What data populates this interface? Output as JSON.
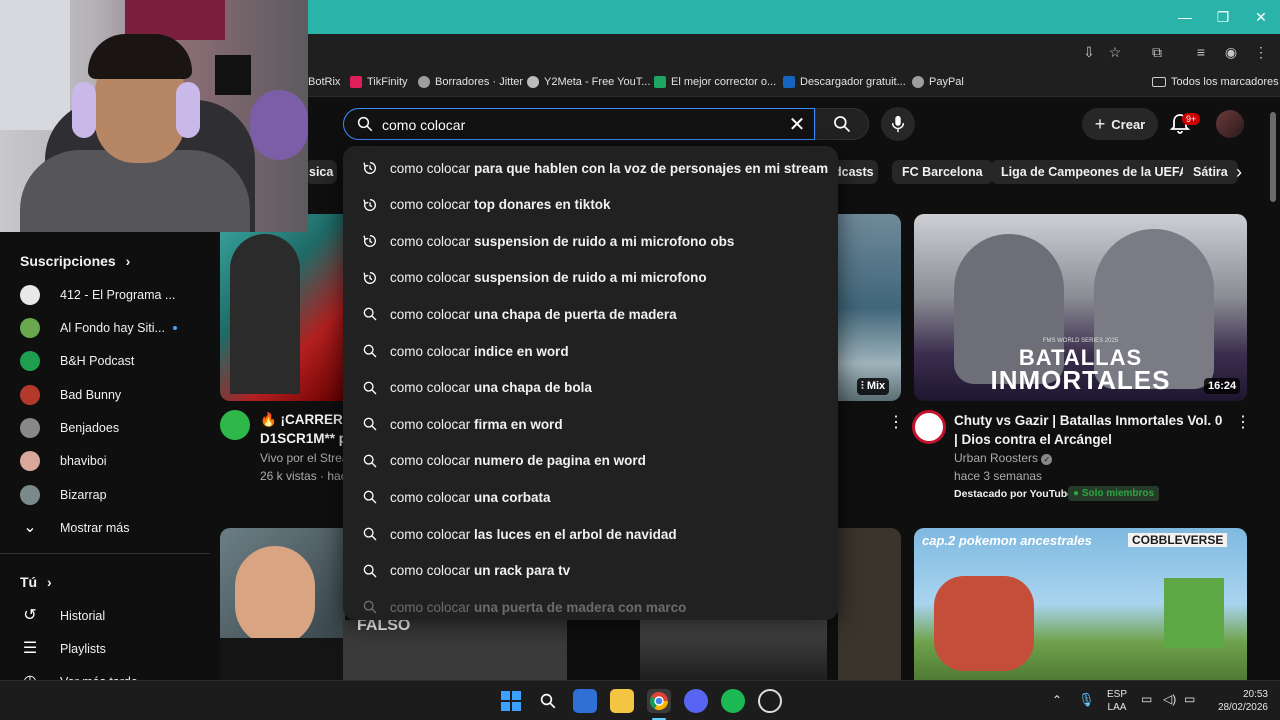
{
  "browser": {
    "window_controls": [
      "—",
      "❐",
      "✕"
    ],
    "bookmarks": [
      {
        "label": "BotRix",
        "color": "#5a5a5a"
      },
      {
        "label": "TikFinity",
        "color": "#e01e5a"
      },
      {
        "label": "Borradores · Jitter",
        "color": "#9e9e9e"
      },
      {
        "label": "Y2Meta - Free YouT...",
        "color": "#bdbdbd"
      },
      {
        "label": "El mejor corrector o...",
        "color": "#1fa463"
      },
      {
        "label": "Descargador gratuit...",
        "color": "#1565c0"
      },
      {
        "label": "PayPal",
        "color": "#9e9e9e"
      }
    ],
    "all_bookmarks": "Todos los marcadores"
  },
  "search": {
    "query": "como colocar",
    "suggestions": [
      {
        "prefix": "como colocar",
        "rest": " para que hablen con la voz de personajes en mi stream",
        "type": "history"
      },
      {
        "prefix": "como colocar",
        "rest": " top donares en tiktok",
        "type": "history"
      },
      {
        "prefix": "como colocar",
        "rest": " suspension de ruido a mi microfono obs",
        "type": "history"
      },
      {
        "prefix": "como colocar",
        "rest": " suspension de ruido a mi microfono",
        "type": "history"
      },
      {
        "prefix": "como colocar",
        "rest": " una chapa de puerta de madera",
        "type": "search"
      },
      {
        "prefix": "como colocar",
        "rest": " indice en word",
        "type": "search"
      },
      {
        "prefix": "como colocar",
        "rest": " una chapa de bola",
        "type": "search"
      },
      {
        "prefix": "como colocar",
        "rest": " firma en word",
        "type": "search"
      },
      {
        "prefix": "como colocar",
        "rest": " numero de pagina en word",
        "type": "search"
      },
      {
        "prefix": "como colocar",
        "rest": " una corbata",
        "type": "search"
      },
      {
        "prefix": "como colocar",
        "rest": " las luces en el arbol de navidad",
        "type": "search"
      },
      {
        "prefix": "como colocar",
        "rest": " un rack para tv",
        "type": "search"
      },
      {
        "prefix": "como colocar",
        "rest": " una puerta de madera con marco",
        "type": "search"
      }
    ]
  },
  "header": {
    "create_label": "Crear",
    "notif_badge": "9+"
  },
  "chips": [
    "sica",
    "dcasts",
    "FC Barcelona",
    "Liga de Campeones de la UEFA",
    "Sátira"
  ],
  "sidebar": {
    "subscriptions_title": "Suscripciones",
    "channels": [
      {
        "name": "412 - El Programa ...",
        "color": "#e8e8e8",
        "dot": false
      },
      {
        "name": "Al Fondo hay Siti...",
        "color": "#6aa84f",
        "dot": true
      },
      {
        "name": "B&H Podcast",
        "color": "#1e9e4f",
        "dot": false
      },
      {
        "name": "Bad Bunny",
        "color": "#b33a2a",
        "dot": false
      },
      {
        "name": "Benjadoes",
        "color": "#888888",
        "dot": false
      },
      {
        "name": "bhaviboi",
        "color": "#d9a89a",
        "dot": false
      },
      {
        "name": "Bizarrap",
        "color": "#7a8a8a",
        "dot": false
      }
    ],
    "show_more": "Mostrar más",
    "you_title": "Tú",
    "you_items": [
      {
        "label": "Historial",
        "icon": "history-icon"
      },
      {
        "label": "Playlists",
        "icon": "playlists-icon"
      },
      {
        "label": "Ver más tarde",
        "icon": "clock-icon"
      }
    ]
  },
  "videos": {
    "left": {
      "title_line1": "🔥 ¡CARRERA",
      "title_line2": "D1SCR1M** p",
      "meta1": "Vivo por el Strea",
      "meta2": "26 k vistas · hac"
    },
    "middle": {
      "badge": "Mix"
    },
    "right": {
      "title": "Chuty vs Gazir | Batallas Inmortales Vol. 0 | Dios contra el Arcángel",
      "channel": "Urban Roosters",
      "time": "hace 3 semanas",
      "highlight": "Destacado por YouTube",
      "members": "Solo miembros",
      "duration": "16:24",
      "thumb_text_small": "FMS WORLD SERIES 2025",
      "thumb_text_big1": "BATALLAS",
      "thumb_text_big2": "INMORTALES"
    },
    "row2_left_label": "FALSO",
    "row2_right_text1": "cap.2 pokemon ancestrales",
    "row2_right_text2": "COBBLEVERSE"
  },
  "taskbar": {
    "lang1": "ESP",
    "lang2": "LAA",
    "time": "20:53",
    "date": "28/02/2026"
  }
}
